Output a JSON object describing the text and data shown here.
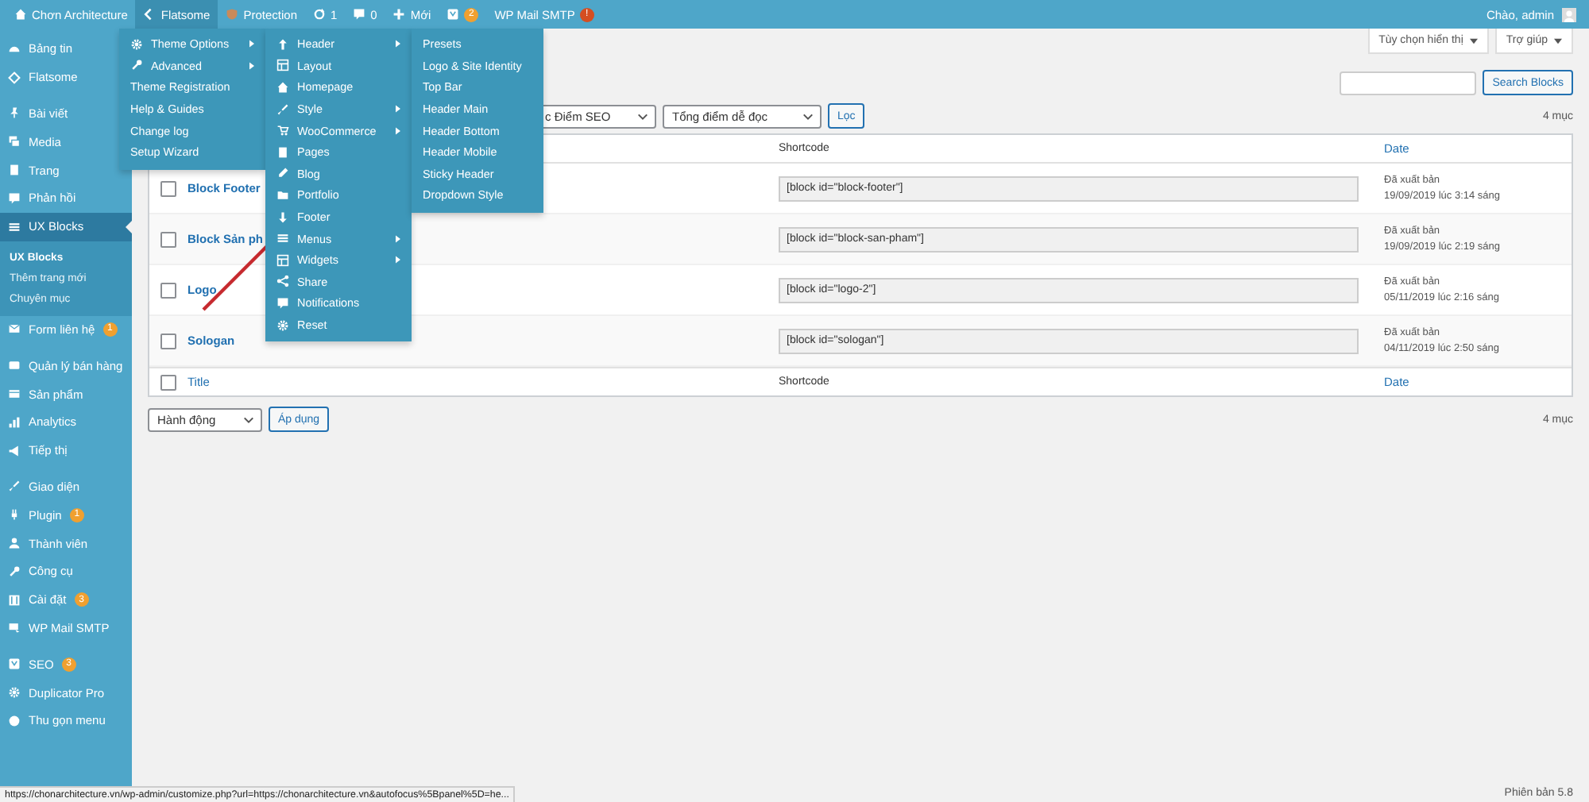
{
  "admin_bar": {
    "items": [
      {
        "label": "Chơn Architecture",
        "selected": false
      },
      {
        "label": "Flatsome",
        "selected": true
      },
      {
        "label": "Protection",
        "selected": false
      },
      {
        "label": "1",
        "selected": false
      },
      {
        "label": "0",
        "selected": false
      },
      {
        "label": "Mới",
        "selected": false
      },
      {
        "badge": "2",
        "color": "#f0a030",
        "selected": false
      },
      {
        "label": "WP Mail SMTP",
        "badge": "!",
        "color": "#d54e21",
        "selected": false
      }
    ],
    "greeting": "Chào, admin"
  },
  "sidebar": {
    "groups": [
      [
        {
          "label": "Bảng tin",
          "selected": false
        },
        {
          "label": "Flatsome",
          "selected": false
        }
      ],
      [
        {
          "label": "Bài viết",
          "selected": false
        },
        {
          "label": "Media",
          "selected": false
        },
        {
          "label": "Trang",
          "selected": false
        },
        {
          "label": "Phản hồi",
          "selected": false
        },
        {
          "label": "UX Blocks",
          "selected": true,
          "children": [
            {
              "label": "UX Blocks",
              "selected": true
            },
            {
              "label": "Thêm trang mới",
              "selected": false
            },
            {
              "label": "Chuyên mục",
              "selected": false
            }
          ]
        },
        {
          "label": "Form liên hệ",
          "badge": "1",
          "selected": false
        }
      ],
      [
        {
          "label": "Quản lý bán hàng",
          "selected": false
        },
        {
          "label": "Sản phẩm",
          "selected": false
        },
        {
          "label": "Analytics",
          "selected": false
        },
        {
          "label": "Tiếp thị",
          "selected": false
        }
      ],
      [
        {
          "label": "Giao diện",
          "selected": false
        },
        {
          "label": "Plugin",
          "badge": "1",
          "selected": false
        },
        {
          "label": "Thành viên",
          "selected": false
        },
        {
          "label": "Công cụ",
          "selected": false
        },
        {
          "label": "Cài đặt",
          "badge": "3",
          "selected": false
        },
        {
          "label": "WP Mail SMTP",
          "selected": false
        }
      ],
      [
        {
          "label": "SEO",
          "badge": "3",
          "selected": false
        },
        {
          "label": "Duplicator Pro",
          "selected": false
        },
        {
          "label": "Thu gọn menu",
          "selected": false
        }
      ]
    ]
  },
  "flatsome_menu": {
    "columns": [
      [
        {
          "label": "Theme Options",
          "has_submenu": true
        },
        {
          "label": "Advanced",
          "has_submenu": true
        },
        {
          "label": "Theme Registration",
          "has_submenu": false
        },
        {
          "label": "Help & Guides",
          "has_submenu": false
        },
        {
          "label": "Change log",
          "has_submenu": false
        },
        {
          "label": "Setup Wizard",
          "has_submenu": false
        }
      ],
      [
        {
          "label": "Header",
          "has_submenu": true
        },
        {
          "label": "Layout",
          "has_submenu": false
        },
        {
          "label": "Homepage",
          "has_submenu": false
        },
        {
          "label": "Style",
          "has_submenu": true
        },
        {
          "label": "WooCommerce",
          "has_submenu": true
        },
        {
          "label": "Pages",
          "has_submenu": false
        },
        {
          "label": "Blog",
          "has_submenu": false
        },
        {
          "label": "Portfolio",
          "has_submenu": false
        },
        {
          "label": "Footer",
          "has_submenu": false
        },
        {
          "label": "Menus",
          "has_submenu": true
        },
        {
          "label": "Widgets",
          "has_submenu": true
        },
        {
          "label": "Share",
          "has_submenu": false
        },
        {
          "label": "Notifications",
          "has_submenu": false
        },
        {
          "label": "Reset",
          "has_submenu": false
        }
      ],
      [
        {
          "label": "Presets",
          "has_submenu": false
        },
        {
          "label": "Logo & Site Identity",
          "has_submenu": false
        },
        {
          "label": "Top Bar",
          "has_submenu": false
        },
        {
          "label": "Header Main",
          "has_submenu": false
        },
        {
          "label": "Header Bottom",
          "has_submenu": false
        },
        {
          "label": "Header Mobile",
          "has_submenu": false
        },
        {
          "label": "Sticky Header",
          "has_submenu": false
        },
        {
          "label": "Dropdown Style",
          "has_submenu": false
        }
      ]
    ]
  },
  "screen_buttons": [
    "Tùy chọn hiển thị",
    "Trợ giúp"
  ],
  "search": {
    "button": "Search Blocks"
  },
  "filters": {
    "selects": [
      "c Điểm SEO",
      "Tổng điểm dễ đọc"
    ],
    "button": "Lọc",
    "count": "4 mục"
  },
  "table": {
    "header": [
      "Shortcode",
      "Date"
    ],
    "rows": [
      {
        "title": "Block Footer",
        "shortcode": "[block id=\"block-footer\"]",
        "status": "Đã xuất bản",
        "date": "19/09/2019 lúc 3:14 sáng",
        "checked": false
      },
      {
        "title": "Block Sản ph",
        "shortcode": "[block id=\"block-san-pham\"]",
        "status": "Đã xuất bản",
        "date": "19/09/2019 lúc 2:19 sáng",
        "checked": false
      },
      {
        "title": "Logo",
        "shortcode": "[block id=\"logo-2\"]",
        "status": "Đã xuất bản",
        "date": "05/11/2019 lúc 2:16 sáng",
        "checked": false
      },
      {
        "title": "Sologan",
        "shortcode": "[block id=\"sologan\"]",
        "status": "Đã xuất bản",
        "date": "04/11/2019 lúc 2:50 sáng",
        "checked": false
      }
    ],
    "footer": [
      "Title",
      "Shortcode",
      "Date"
    ],
    "footer_checked": false
  },
  "bulk": {
    "select": "Hành động",
    "button": "Áp dụng",
    "count": "4 mục"
  },
  "version": "Phiên bản 5.8",
  "status_url": "https://chonarchitecture.vn/wp-admin/customize.php?url=https://chonarchitecture.vn&autofocus%5Bpanel%5D=he..."
}
